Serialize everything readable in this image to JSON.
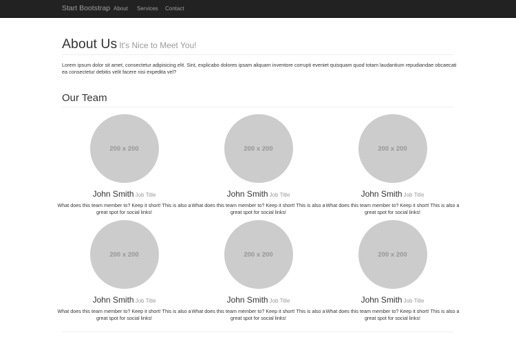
{
  "navbar": {
    "brand": "Start Bootstrap",
    "links": [
      "About",
      "Services",
      "Contact"
    ],
    "bg_color": "#222222",
    "text_color": "#9d9d9d"
  },
  "header": {
    "title": "About Us",
    "subtitle": "It's Nice to Meet You!"
  },
  "intro": "Lorem ipsum dolor sit amet, consectetur adipisicing elit. Sint, explicabo dolores ipsam aliquam inventore corrupti eveniet quisquam quod totam laudantium repudiandae obcaecati ea consectetur debitis velit facere nisi expedita vel?",
  "team": {
    "title": "Our Team",
    "members": [
      {
        "placeholder": "200 x 200",
        "name": "John Smith",
        "job": "Job Title",
        "desc": "What does this team member to? Keep it short! This is also a great spot for social links!"
      },
      {
        "placeholder": "200 x 200",
        "name": "John Smith",
        "job": "Job Title",
        "desc": "What does this team member to? Keep it short! This is also a great spot for social links!"
      },
      {
        "placeholder": "200 x 200",
        "name": "John Smith",
        "job": "Job Title",
        "desc": "What does this team member to? Keep it short! This is also a great spot for social links!"
      },
      {
        "placeholder": "200 x 200",
        "name": "John Smith",
        "job": "Job Title",
        "desc": "What does this team member to? Keep it short! This is also a great spot for social links!"
      },
      {
        "placeholder": "200 x 200",
        "name": "John Smith",
        "job": "Job Title",
        "desc": "What does this team member to? Keep it short! This is also a great spot for social links!"
      },
      {
        "placeholder": "200 x 200",
        "name": "John Smith",
        "job": "Job Title",
        "desc": "What does this team member to? Keep it short! This is also a great spot for social links!"
      }
    ]
  },
  "colors": {
    "avatar": "#cccccc",
    "muted": "#999999",
    "text": "#333333"
  }
}
